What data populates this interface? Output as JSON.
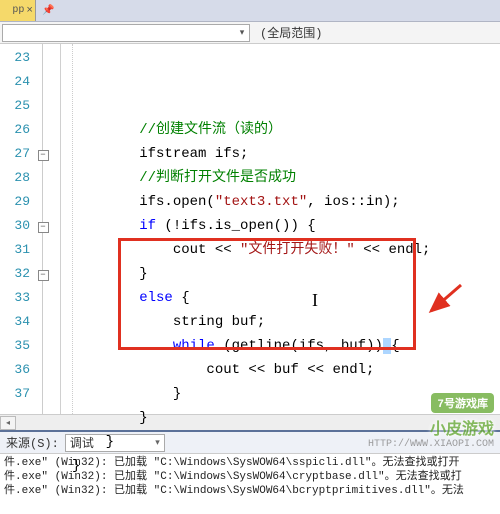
{
  "top": {
    "tab_suffix": "pp",
    "close": "×",
    "pin": "📌"
  },
  "scope": {
    "dropdown_text": "(全局范围)"
  },
  "lines": {
    "start": 23,
    "rows": [
      {
        "n": 23,
        "fold": "",
        "html": "        <span class='cmt'>//创建文件流（读的）</span>"
      },
      {
        "n": 24,
        "fold": "",
        "html": "        ifstream ifs;"
      },
      {
        "n": 25,
        "fold": "",
        "html": "        <span class='cmt'>//判断打开文件是否成功</span>"
      },
      {
        "n": 26,
        "fold": "",
        "html": "        ifs.open(<span class='str'>\"text3.txt\"</span>, ios::in);"
      },
      {
        "n": 27,
        "fold": "-",
        "html": "        <span class='kw'>if</span> (!ifs.is_open()) {"
      },
      {
        "n": 28,
        "fold": "",
        "html": "            cout &lt;&lt; <span class='str'>\"文件打开失败！\"</span> &lt;&lt; endl;"
      },
      {
        "n": 29,
        "fold": "",
        "html": "        }"
      },
      {
        "n": 30,
        "fold": "-",
        "html": "        <span class='kw'>else</span> {"
      },
      {
        "n": 31,
        "fold": "",
        "html": "            string buf;"
      },
      {
        "n": 32,
        "fold": "-",
        "html": "            <span class='kw'>while</span> (getline(ifs, buf))<span class='sel'> </span>{"
      },
      {
        "n": 33,
        "fold": "",
        "html": "                cout &lt;&lt; buf &lt;&lt; endl;"
      },
      {
        "n": 34,
        "fold": "",
        "html": "            }"
      },
      {
        "n": 35,
        "fold": "",
        "html": "        }"
      },
      {
        "n": 36,
        "fold": "",
        "html": "    }"
      },
      {
        "n": 37,
        "fold": "",
        "html": "}"
      }
    ]
  },
  "output": {
    "source_label": "来源(S):",
    "source_value": "调试",
    "lines": [
      "件.exe\" (Win32): 已加载 \"C:\\Windows\\SysWOW64\\sspicli.dll\"。无法查找或打开",
      "件.exe\" (Win32): 已加载 \"C:\\Windows\\SysWOW64\\cryptbase.dll\"。无法查找或打",
      "件.exe\" (Win32): 已加载 \"C:\\Windows\\SysWOW64\\bcryptprimitives.dll\"。无法"
    ]
  },
  "watermark": {
    "badge": "7号游戏库",
    "text": "小皮游戏",
    "url": "HTTP://WWW.XIAOPI.COM"
  },
  "chart_data": null
}
